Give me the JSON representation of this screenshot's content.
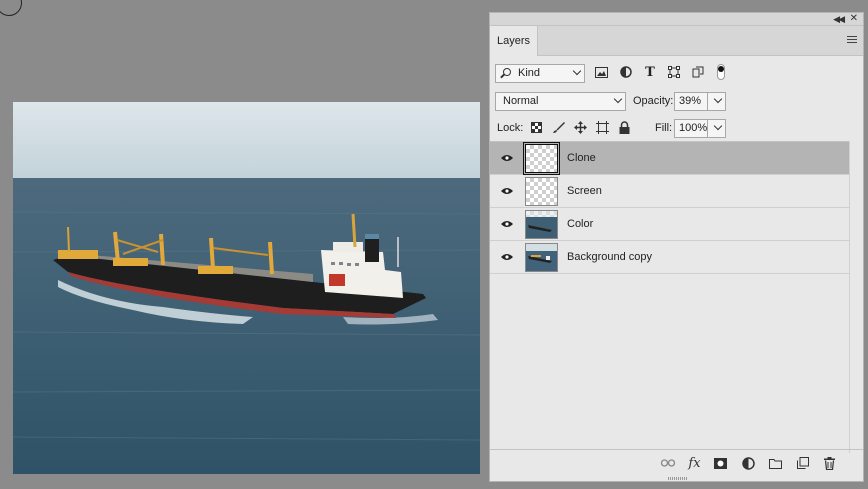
{
  "panel": {
    "tab_label": "Layers",
    "filter": {
      "kind_label": "Kind"
    },
    "blend_mode": "Normal",
    "opacity_label": "Opacity:",
    "opacity_value": "39%",
    "lock_label": "Lock:",
    "fill_label": "Fill:",
    "fill_value": "100%",
    "layers": [
      {
        "name": "Clone",
        "visible": true,
        "selected": true,
        "thumb": "transparent"
      },
      {
        "name": "Screen",
        "visible": true,
        "selected": false,
        "thumb": "transparent"
      },
      {
        "name": "Color",
        "visible": true,
        "selected": false,
        "thumb": "partial-photo"
      },
      {
        "name": "Background copy",
        "visible": true,
        "selected": false,
        "thumb": "photo"
      }
    ]
  },
  "icons": {
    "filter": [
      "image-filter-icon",
      "adjustment-filter-icon",
      "type-filter-icon",
      "shape-filter-icon",
      "smart-object-filter-icon"
    ],
    "lock": [
      "lock-transparent-pixels-icon",
      "lock-image-pixels-icon",
      "lock-position-icon",
      "lock-artboard-icon",
      "lock-all-icon"
    ],
    "bottom": [
      "link-layers-icon",
      "fx-icon",
      "add-mask-icon",
      "adjustment-layer-icon",
      "new-group-icon",
      "new-layer-icon",
      "delete-layer-icon"
    ]
  },
  "colors": {
    "workspace": "#8b8b8b",
    "panel": "#e8e8e8",
    "selected_layer": "#b4b4b4"
  }
}
